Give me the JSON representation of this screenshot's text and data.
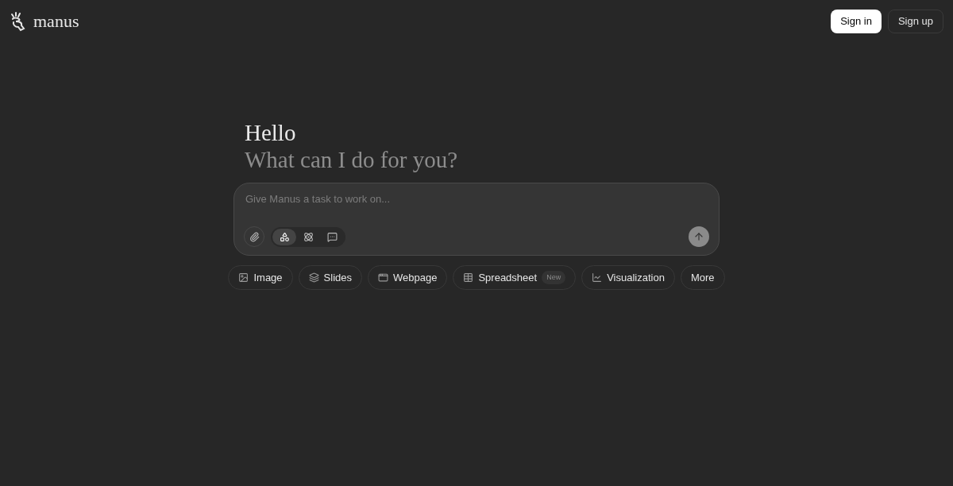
{
  "header": {
    "logo_text": "manus",
    "buttons": [
      {
        "label": "Sign in",
        "kind": "primary"
      },
      {
        "label": "Sign up",
        "kind": "secondary"
      }
    ]
  },
  "greeting": {
    "title": "Hello",
    "subtitle": "What can I do for you?"
  },
  "composer": {
    "placeholder": "Give Manus a task to work on...",
    "modes": [
      {
        "kind": "agent",
        "selected": true
      },
      {
        "kind": "research",
        "selected": false
      },
      {
        "kind": "chat",
        "selected": false
      }
    ]
  },
  "quick_actions": [
    {
      "label": "Image",
      "kind": "image"
    },
    {
      "label": "Slides",
      "kind": "slides"
    },
    {
      "label": "Webpage",
      "kind": "webpage"
    },
    {
      "label": "Spreadsheet",
      "kind": "spreadsheet",
      "badge": "New"
    },
    {
      "label": "Visualization",
      "kind": "visualization"
    },
    {
      "label": "More",
      "kind": "more"
    }
  ]
}
